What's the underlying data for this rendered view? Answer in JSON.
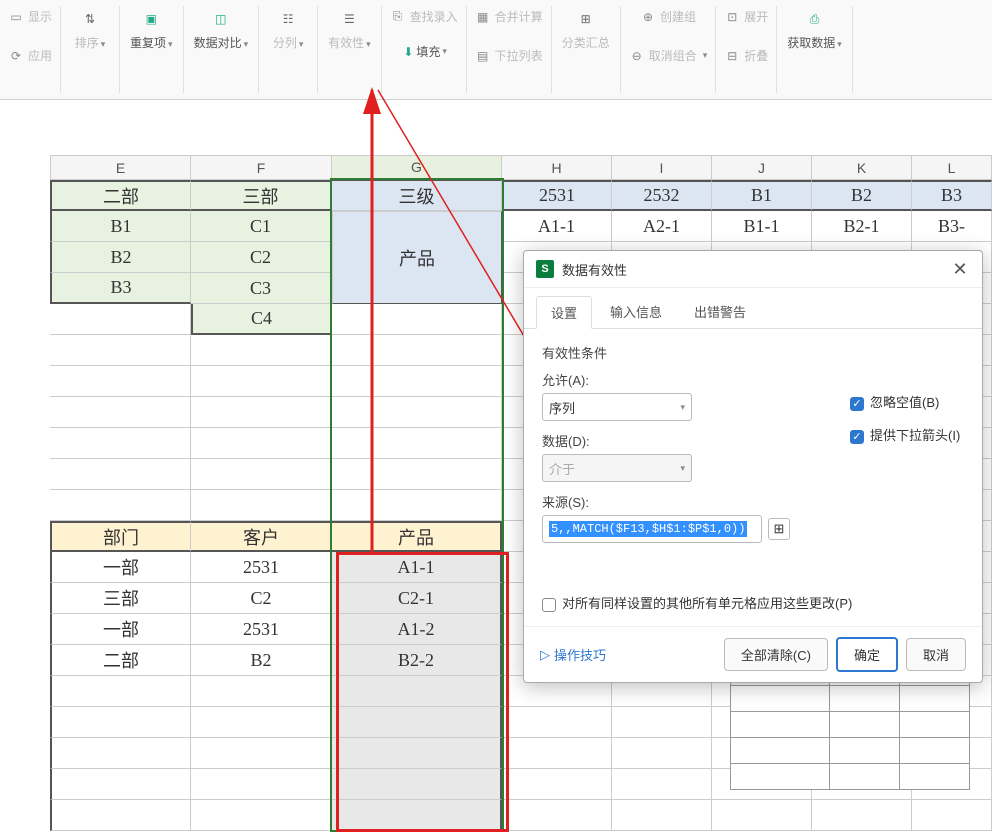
{
  "ribbon": {
    "display": "显示",
    "apply": "应用",
    "sort": "排序",
    "dup": "重复项",
    "compare": "数据对比",
    "split": "分列",
    "validity": "有效性",
    "fill": "填充",
    "findrec": "查找录入",
    "merge": "合并计算",
    "dropdown": "下拉列表",
    "group_sum": "分类汇总",
    "create_group": "创建组",
    "ungroup": "取消组合",
    "expand": "展开",
    "collapse": "折叠",
    "getdata": "获取数据"
  },
  "cols": [
    "E",
    "F",
    "G",
    "H",
    "I",
    "J",
    "K",
    "L"
  ],
  "top_table": {
    "r1": [
      "二部",
      "三部",
      "三级",
      "2531",
      "2532",
      "B1",
      "B2",
      "B3"
    ],
    "r2": [
      "B1",
      "C1",
      "",
      "A1-1",
      "A2-1",
      "B1-1",
      "B2-1",
      "B3-"
    ],
    "r3": [
      "B2",
      "C2",
      "产品"
    ],
    "r4": [
      "B3",
      "C3"
    ],
    "r5": [
      "",
      "C4"
    ]
  },
  "bottom_table": {
    "headers": [
      "部门",
      "客户",
      "产品"
    ],
    "rows": [
      [
        "一部",
        "2531",
        "A1-1"
      ],
      [
        "三部",
        "C2",
        "C2-1"
      ],
      [
        "一部",
        "2531",
        "A1-2"
      ],
      [
        "二部",
        "B2",
        "B2-2"
      ]
    ]
  },
  "dialog": {
    "title": "数据有效性",
    "tabs": [
      "设置",
      "输入信息",
      "出错警告"
    ],
    "section": "有效性条件",
    "allow_label": "允许(A):",
    "allow_value": "序列",
    "data_label": "数据(D):",
    "data_value": "介于",
    "source_label": "来源(S):",
    "source_value": "5,,MATCH($F13,$H$1:$P$1,0))",
    "ignore_blank": "忽略空值(B)",
    "provide_dropdown": "提供下拉箭头(I)",
    "apply_all": "对所有同样设置的其他所有单元格应用这些更改(P)",
    "tips": "操作技巧",
    "clear": "全部清除(C)",
    "ok": "确定",
    "cancel": "取消"
  },
  "side_label": "三部"
}
